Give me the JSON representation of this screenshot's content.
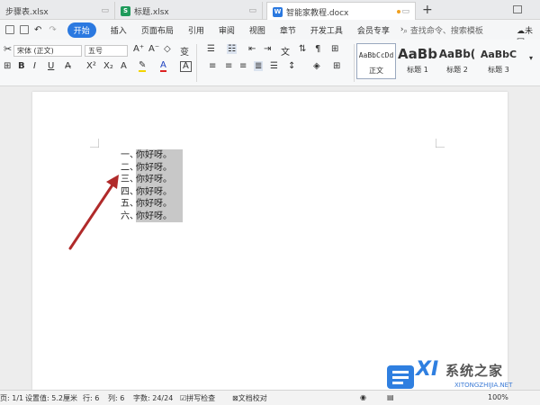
{
  "tabs": [
    {
      "label": "步骤表.xlsx",
      "icon": "spreadsheet-icon"
    },
    {
      "label": "标题.xlsx",
      "icon": "spreadsheet-icon"
    },
    {
      "label": "智能家教程.docx",
      "icon": "word-doc-icon"
    }
  ],
  "menu": {
    "items": [
      "开始",
      "插入",
      "页面布局",
      "引用",
      "审阅",
      "视图",
      "章节",
      "开发工具",
      "会员专享"
    ],
    "search_placeholder": "查找命令、搜索模板",
    "cloud_label": "未同"
  },
  "toolbar": {
    "font_name": "宋体 (正文)",
    "font_size": "五号",
    "styles": [
      {
        "preview": "AaBbCcDd",
        "name": "正文"
      },
      {
        "preview": "AaBb",
        "name": "标题 1"
      },
      {
        "preview": "AaBb(",
        "name": "标题 2"
      },
      {
        "preview": "AaBbC",
        "name": "标题 3"
      }
    ]
  },
  "document": {
    "list": [
      {
        "num": "一、",
        "text": "你好呀。"
      },
      {
        "num": "二、",
        "text": "你好呀。"
      },
      {
        "num": "三、",
        "text": "你好呀。"
      },
      {
        "num": "四、",
        "text": "你好呀。"
      },
      {
        "num": "五、",
        "text": "你好呀。"
      },
      {
        "num": "六、",
        "text": "你好呀。"
      }
    ]
  },
  "status": {
    "page": "页: 1/1",
    "position": "设置值: 5.2厘米",
    "row": "行: 6",
    "col": "列: 6",
    "wordcount": "字数: 24/24",
    "spellcheck": "拼写检查",
    "proof": "文档校对",
    "zoom": "100%"
  },
  "watermark": {
    "brand": "XI",
    "text": "系统之家",
    "url": "XITONGZHIJIA.NET"
  },
  "colors": {
    "accent": "#2b79e0",
    "arrow": "#b02a2a",
    "highlight": "#c8c8c8"
  }
}
